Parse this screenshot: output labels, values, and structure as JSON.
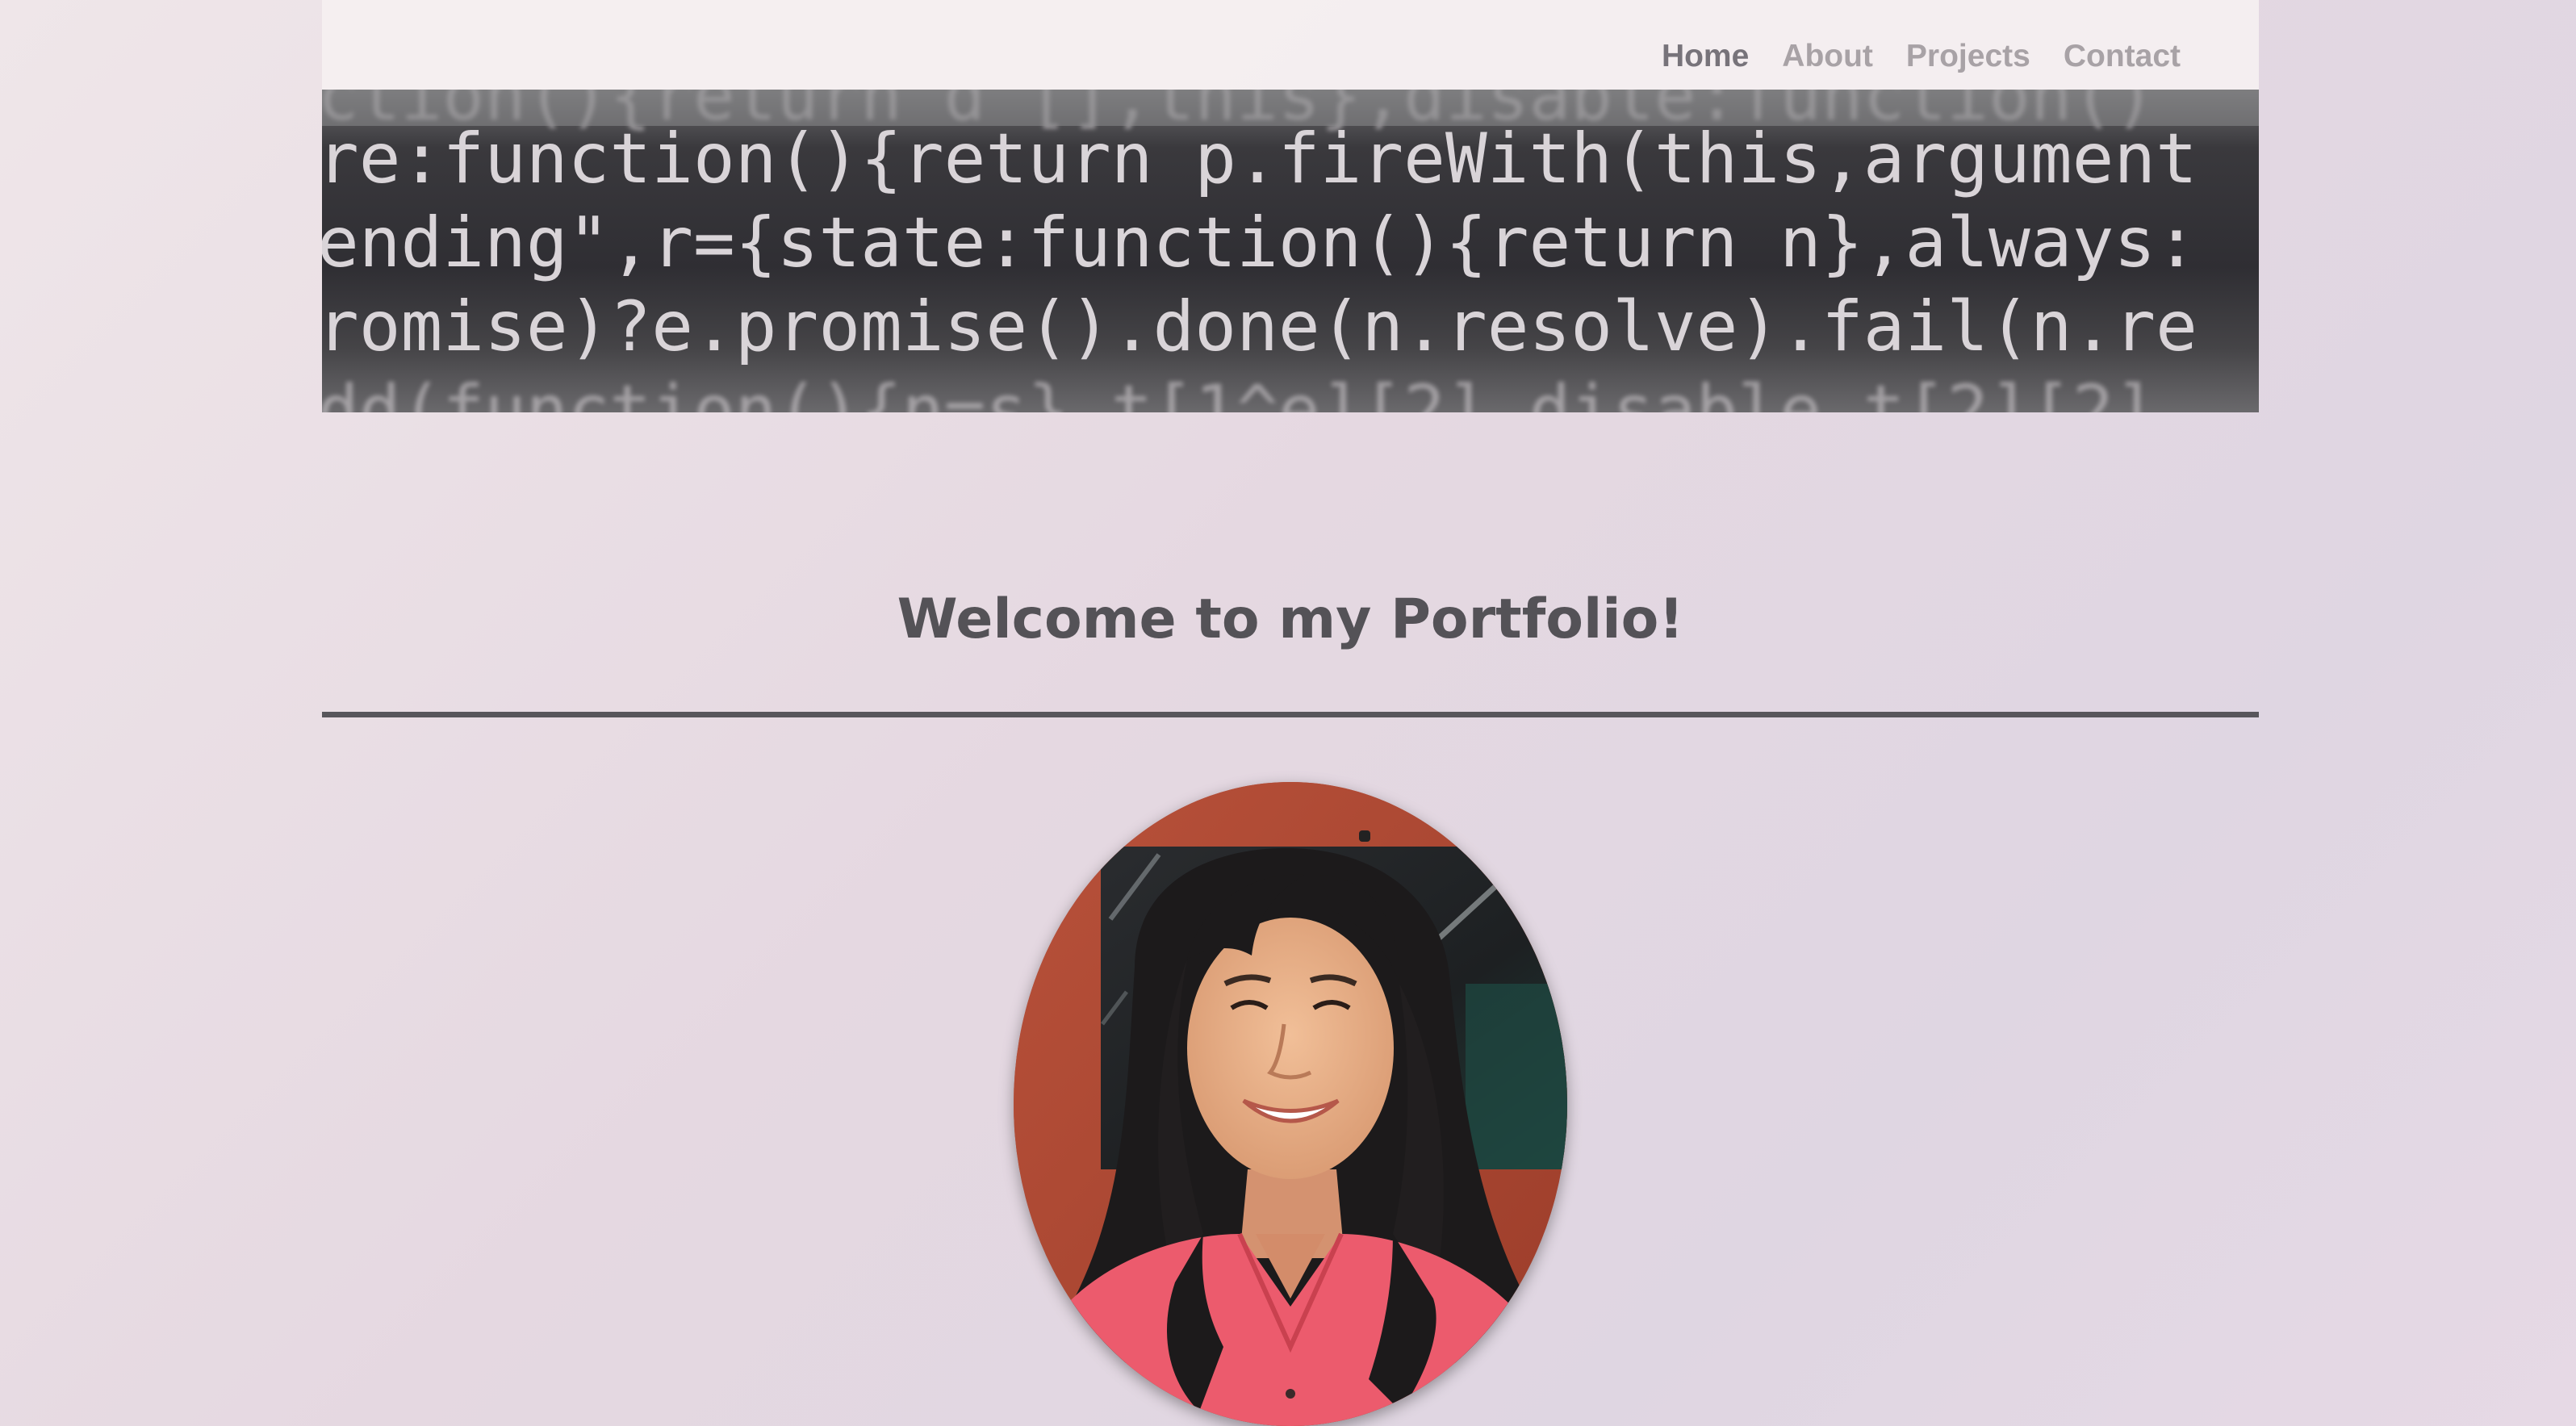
{
  "nav": {
    "items": [
      {
        "label": "Home",
        "active": true
      },
      {
        "label": "About",
        "active": false
      },
      {
        "label": "Projects",
        "active": false
      },
      {
        "label": "Contact",
        "active": false
      }
    ]
  },
  "banner": {
    "code_lines": [
      "ction(){return d [],this},disable:function()",
      "re:function(){return p.fireWith(this,argument",
      "ending\",r={state:function(){return n},always:",
      "romise)?e.promise().done(n.resolve).fail(n.re",
      "dd(function(){n=s},t[1^e][2].disable,t[2][2]."
    ]
  },
  "main": {
    "heading": "Welcome to my Portfolio!"
  },
  "colors": {
    "nav_active": "#77737a",
    "nav_inactive": "#a8a2a6",
    "heading": "#545257",
    "divider": "#58565b"
  }
}
